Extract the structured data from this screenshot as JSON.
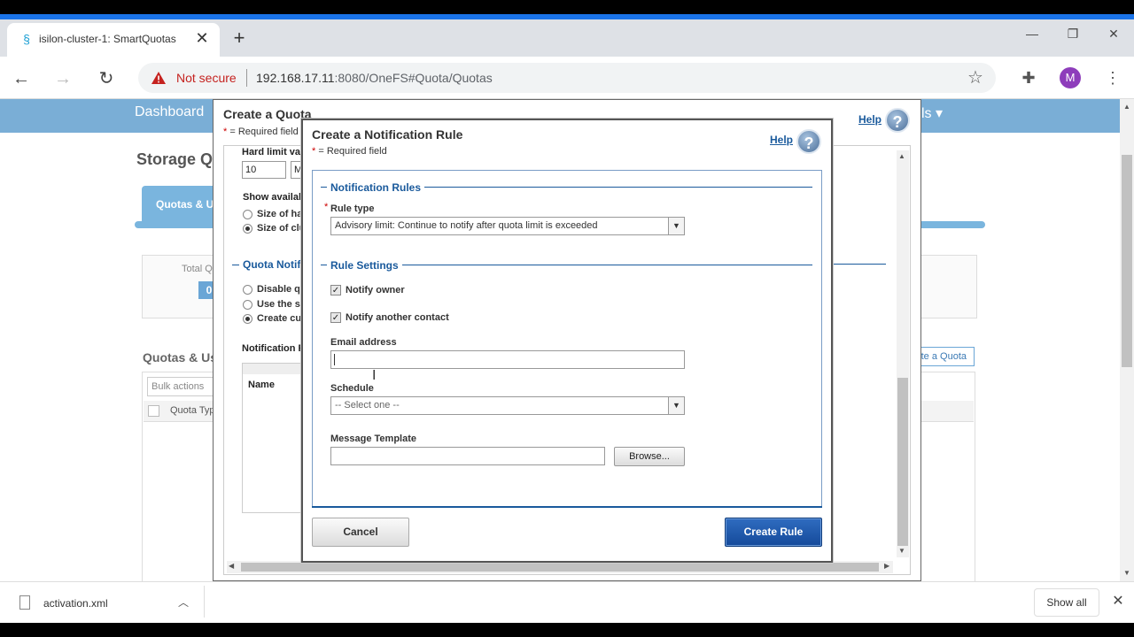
{
  "browser": {
    "tab_title": "isilon-cluster-1: SmartQuotas",
    "security_label": "Not secure",
    "url_host": "192.168.17.11",
    "url_path": ":8080/OneFS#Quota/Quotas",
    "profile_initial": "M",
    "colors": {
      "tab_strip_accent": "#1a73e8",
      "not_secure": "#c5221f",
      "avatar": "#8e3dbb"
    }
  },
  "page": {
    "nav_dashboard": "Dashboard",
    "nav_right_fragment": "ls ▾",
    "title_fragment": "Storage Q",
    "tab_fragment": "Quotas & U",
    "total_fragment": "Total Q",
    "total_value": "0",
    "quotas_heading_fragment": "Quotas & Us",
    "bulk_actions": "Bulk actions",
    "col_quota_type_fragment": "Quota Typ",
    "create_quota_fragment": "te a Quota"
  },
  "create_quota": {
    "title": "Create a Quota",
    "required_note": "= Required field",
    "help": "Help",
    "hard_limit_label_fragment": "Hard limit va",
    "hard_limit_value": "10",
    "hard_limit_unit_fragment": "M",
    "show_available_fragment": "Show availab",
    "radio_size_hard_fragment": "Size of ha",
    "radio_size_cluster_fragment": "Size of clu",
    "section_quota_notif_fragment": "Quota Notifi",
    "radio_disable_fragment": "Disable q",
    "radio_use_fragment": "Use the s",
    "radio_create_fragment": "Create cu",
    "notification_rules_fragment": "Notification R",
    "col_name": "Name"
  },
  "notification_rule": {
    "title": "Create a Notification Rule",
    "required_note": "= Required field",
    "help": "Help",
    "section_rules": "Notification Rules",
    "rule_type_label": "Rule type",
    "rule_type_value": "Advisory limit: Continue to notify after quota limit is exceeded",
    "section_settings": "Rule Settings",
    "notify_owner": "Notify owner",
    "notify_owner_checked": true,
    "notify_another": "Notify another contact",
    "notify_another_checked": true,
    "email_label": "Email address",
    "email_value": "",
    "schedule_label": "Schedule",
    "schedule_value": "-- Select one --",
    "template_label": "Message Template",
    "template_value": "",
    "browse": "Browse...",
    "cancel": "Cancel",
    "create_rule": "Create Rule"
  },
  "downloads": {
    "file_name": "activation.xml",
    "show_all": "Show all"
  }
}
